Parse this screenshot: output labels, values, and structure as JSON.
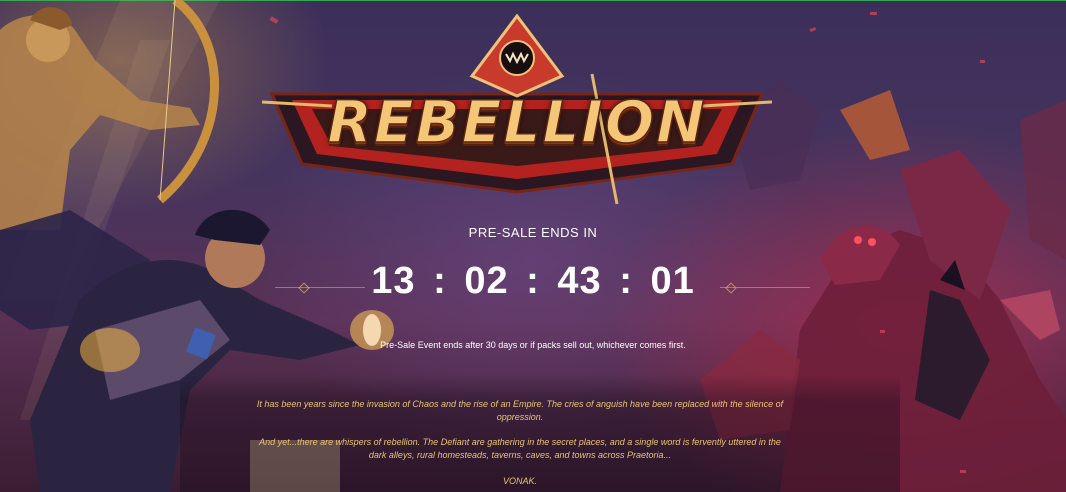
{
  "logo": {
    "title": "REBELLION",
    "emblem_icon": "fanged-mouth-emblem-icon"
  },
  "presale": {
    "heading": "PRE-SALE ENDS IN",
    "countdown": {
      "days": "13",
      "hours": "02",
      "minutes": "43",
      "seconds": "01",
      "separator": ":"
    },
    "note": "Pre-Sale Event ends after 30 days or if packs sell out, whichever comes first."
  },
  "story": {
    "paragraph_1": "It has been years since the invasion of Chaos and the rise of an Empire. The cries of anguish have been replaced with the silence of oppression.",
    "paragraph_2": "And yet...there are whispers of rebellion. The Defiant are gathering in the secret places, and a single word is fervently uttered in the dark alleys, rural homesteads, taverns, caves, and towns across Praetoria...",
    "paragraph_3": "VONAK."
  },
  "colors": {
    "accent_gold": "#e7c575",
    "logo_red": "#b3221f",
    "background": "#3b2f5a",
    "enemy_glow": "#d62e50"
  }
}
